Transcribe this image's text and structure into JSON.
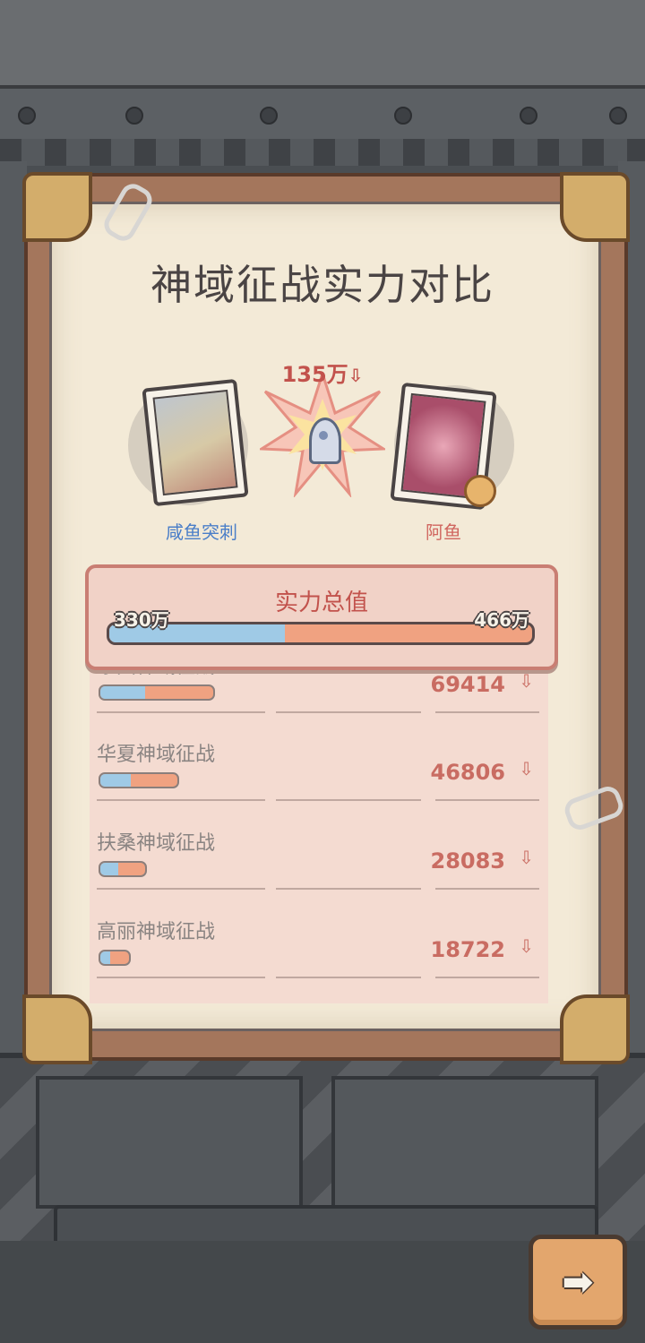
{
  "title": "神域征战实力对比",
  "versus": {
    "diff_value": "135万",
    "diff_trend": "down",
    "left_player": "咸鱼突刺",
    "right_player": "阿鱼"
  },
  "total": {
    "label": "实力总值",
    "left_value": "330万",
    "right_value": "466万",
    "left_share": 0.415
  },
  "rows": [
    {
      "label": "东国神域征战",
      "value": "69414",
      "trend": "down",
      "left_share": 0.4
    },
    {
      "label": "华夏神域征战",
      "value": "46806",
      "trend": "down",
      "left_share": 0.4
    },
    {
      "label": "扶桑神域征战",
      "value": "28083",
      "trend": "down",
      "left_share": 0.4
    },
    {
      "label": "高丽神域征战",
      "value": "18722",
      "trend": "down",
      "left_share": 0.35
    }
  ],
  "icons": {
    "rocket": "rocket-icon",
    "down_arrow": "arrow-down-icon",
    "next": "arrow-right-icon",
    "medal": "medal-icon"
  },
  "colors": {
    "left_accent": "#4a7ec8",
    "right_accent": "#d0665f",
    "bar_blue": "#9fcae6",
    "bar_orange": "#f0a281"
  }
}
